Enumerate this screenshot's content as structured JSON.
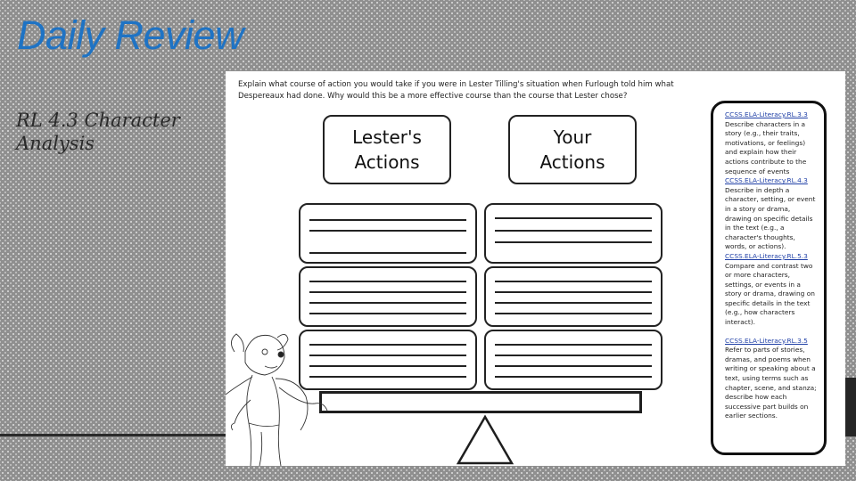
{
  "slide": {
    "title": "Daily Review",
    "subtitle": "RL 4.3 Character Analysis",
    "title_color": "#1f73c4"
  },
  "worksheet": {
    "prompt": "Explain what course of action you would take if you were in Lester Tilling's situation when Furlough told him what Despereaux had done. Why would this be a more effective course than the course that Lester chose?",
    "columns": [
      {
        "heading_line1": "Lester's",
        "heading_line2": "Actions"
      },
      {
        "heading_line1": "Your",
        "heading_line2": "Actions"
      }
    ],
    "standards": [
      {
        "code": "CCSS.ELA-Literacy.RL.3.3",
        "description": "Describe characters in a story (e.g., their traits, motivations, or feelings) and explain how their actions contribute to the sequence of events"
      },
      {
        "code": "CCSS.ELA-Literacy.RL.4.3",
        "description": "Describe in depth a character, setting, or event in a story or drama, drawing on specific details in the text (e.g., a character's thoughts, words, or actions)."
      },
      {
        "code": "CCSS.ELA-Literacy.RL.5.3",
        "description": "Compare and contrast two or more characters, settings, or events in a story or drama, drawing on specific details in the text (e.g., how characters interact)."
      },
      {
        "code": "CCSS.ELA-Literacy.RL.3.5",
        "description": "Refer to parts of stories, dramas, and poems when writing or speaking about a text, using terms such as chapter, scene, and stanza; describe how each successive part builds on earlier sections."
      }
    ],
    "illustration": "mouse-character-icon",
    "scale_icon": "seesaw-balance-icon"
  }
}
